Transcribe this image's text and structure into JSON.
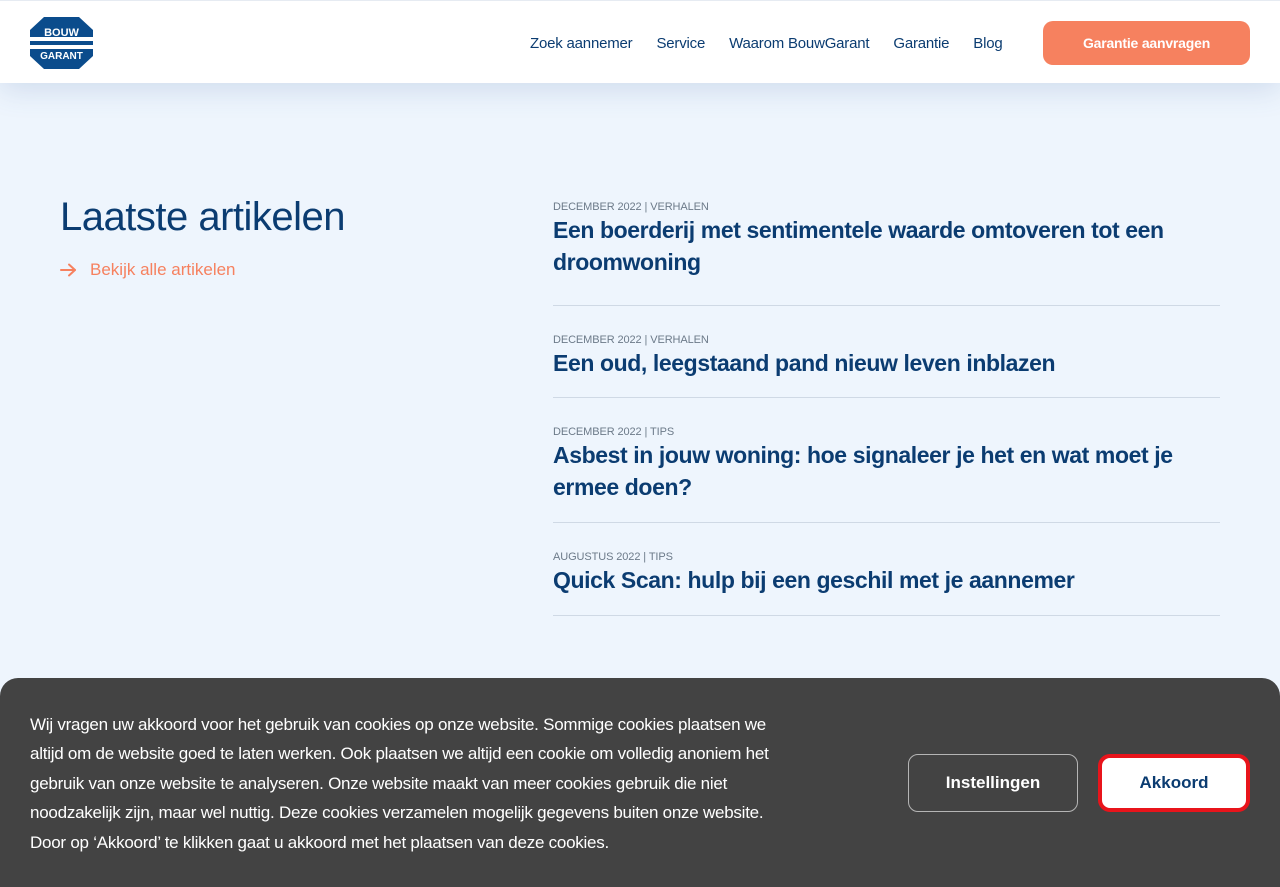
{
  "header": {
    "logo_text": [
      "BOUW",
      "GARANT"
    ],
    "nav": [
      "Zoek aannemer",
      "Service",
      "Waarom BouwGarant",
      "Garantie",
      "Blog"
    ],
    "cta": "Garantie aanvragen"
  },
  "main": {
    "section_title": "Laatste artikelen",
    "all_link": "Bekijk alle artikelen",
    "articles": [
      {
        "meta": "DECEMBER 2022 | VERHALEN",
        "title": "Een boerderij met sentimentele waarde omtoveren tot een droomwoning"
      },
      {
        "meta": "DECEMBER 2022 | VERHALEN",
        "title": "Een oud, leegstaand pand nieuw leven inblazen"
      },
      {
        "meta": "DECEMBER 2022 | TIPS",
        "title": "Asbest in jouw woning: hoe signaleer je het en wat moet je ermee doen?"
      },
      {
        "meta": "AUGUSTUS 2022 | TIPS",
        "title": "Quick Scan: hulp bij een geschil met je aannemer"
      }
    ]
  },
  "cookie": {
    "text": "Wij vragen uw akkoord voor het gebruik van cookies op onze website. Sommige cookies plaatsen we altijd om de website goed te laten werken. Ook plaatsen we altijd een cookie om volledig anoniem het gebruik van onze website te analyseren. Onze website maakt van meer cookies gebruik die niet noodzakelijk zijn, maar wel nuttig. Deze cookies verzamelen mogelijk gegevens buiten onze website. Door op ‘Akkoord’ te klikken gaat u akkoord met het plaatsen van deze cookies.",
    "settings_label": "Instellingen",
    "accept_label": "Akkoord"
  },
  "colors": {
    "brand_blue": "#0b3c71",
    "accent_orange": "#f6815f",
    "page_bg": "#eef5fd",
    "cookie_bg": "#434343",
    "focus_red": "#e8141b"
  },
  "icons": [
    "bouwgarant-logo",
    "arrow-right-icon"
  ]
}
